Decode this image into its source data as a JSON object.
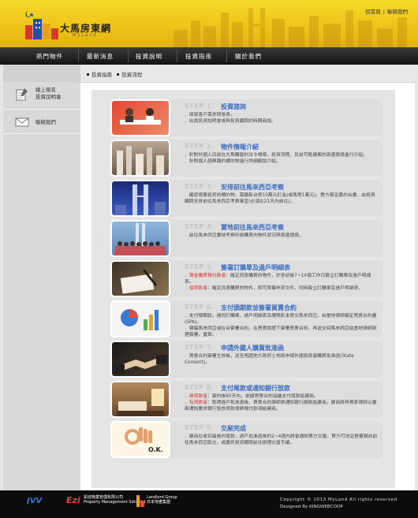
{
  "header": {
    "logo_text": "大馬房東網",
    "logo_sub": "MyLand",
    "links": [
      "回首頁",
      "聯絡我們"
    ]
  },
  "nav": {
    "items": [
      "熱門物件",
      "最新消息",
      "投資說明",
      "投資指南",
      "關於我們"
    ]
  },
  "sidebar": {
    "items": [
      {
        "label": "線上報名\n投資說明會",
        "icon": "pencil-note-icon"
      },
      {
        "label": "聯絡我們",
        "icon": "envelope-icon"
      }
    ]
  },
  "breadcrumb": [
    "投資指南",
    "投資流程"
  ],
  "steps": [
    {
      "num": "STEP 1.",
      "title": "投資諮詢",
      "desc": [
        "．填寫客戶需求問卷表。",
        "．出席投資說明會或與投資顧問約時間商談。"
      ]
    },
    {
      "num": "STEP 2.",
      "title": "物件情報介紹",
      "desc": [
        "．針對外國人目前在大馬購屋的法令規章、投資流程、目前可售建案的周邊環境進行介紹。",
        "．針對個人感興趣的標的物進行詳細解說介紹。"
      ]
    },
    {
      "num": "STEP 3.",
      "title": "安排前往馬來西亞考察",
      "desc": [
        "．確認想要投資的標的物，需繳新台幣10萬元訂金(或馬幣1萬元)，雙方簽定委約合書，由投資顧問安排前往馬來西亞考察事宜(必須在21天內前往)。"
      ]
    },
    {
      "num": "STEP 4.",
      "title": "實地前往馬來西亞考察",
      "desc": [
        "．前往馬來西亞實地考察所欲購買的物件狀況與周邊環境。"
      ]
    },
    {
      "num": "STEP 5.",
      "title": "簽署訂購單及過戶明細表",
      "desc_parts": [
        {
          "label": "現金購買預付款者",
          "text": "：確定同意購買的物件，於參訪後7~14個工作日簽立訂購單及過戶明細表。"
        },
        {
          "label": "借貸款者",
          "text": "：確定同意購買的物件，即可準備申貸文件，同時簽立訂購單及過戶明細表。"
        }
      ]
    },
    {
      "num": "STEP 6.",
      "title": "支付頭期款並簽署買賣合約",
      "desc": [
        "．支付頭期款，連同訂購單、過戶明細表及護照影本寄交馬來西亞，由當地律師擬定買賣合約書(SPA)。",
        "．親臨馬來西亞或在台簽署合約，在買賣認證下簽署買賣合約，再送交回馬來西亞給當地律師辦理簽署，蓋章。"
      ]
    },
    {
      "num": "STEP 7.",
      "title": "申請外國人購買批准函",
      "desc": [
        "．買賣合約簽署生效後，送至馬國地方政府土地局申請外國投資者購買批准函(State Consent)。"
      ]
    },
    {
      "num": "STEP 8.",
      "title": "支付尾款或通知銀行放款",
      "desc_parts": [
        {
          "label": "無貸款者",
          "text": "：簽約後60天內，依據買賣合約協議支付尾款給建商。"
        },
        {
          "label": "有貸款者",
          "text": "：取得過戶批准函後，買賣合約律師將通知銀行撥款給建商。建商將與買家律師以書面通知要求銀行發放貸款律師撥付款項給建商。"
        }
      ]
    },
    {
      "num": "STEP 9.",
      "title": "交屋完成",
      "desc": [
        "．建商在收到最後的尾款，過戶批准函後的2~4週內將會通知買方交屋，買方可決定是要親自前往馬來西亞取交，或委託投資顧問前往辦理交屋手續。"
      ],
      "badge": "O.K."
    }
  ],
  "footer": {
    "copyright": "Copyright © 2013  MyLand All rights reserved",
    "designed_by": "Designed By",
    "designer": "KINGWEBCOOP",
    "logos": [
      "JVV",
      "EziProperty Management Sdn Bhd",
      "Landlord Group"
    ],
    "logo_texts": [
      "凱迪物業管理有限公司",
      "Property Management Sdn Bhd",
      "Landlord Group",
      "日本地產集團"
    ]
  },
  "colors": {
    "accent": "#3a6cc0",
    "header": "#f1cf1f",
    "alert": "#d03030"
  }
}
